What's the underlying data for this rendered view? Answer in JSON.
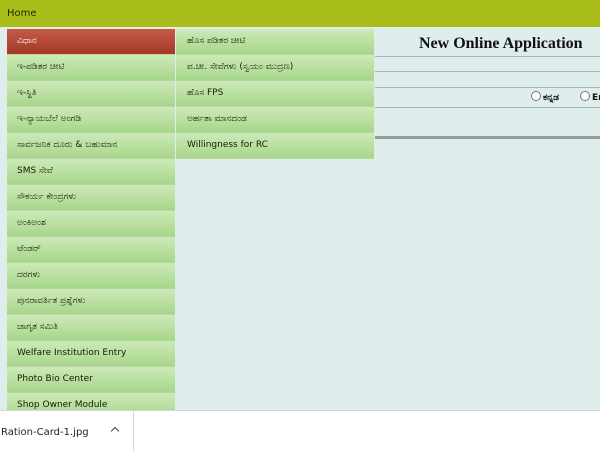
{
  "topbar": {
    "home_label": "Home"
  },
  "app": {
    "title": "New Online Application"
  },
  "language": {
    "kannada": "ಕನ್ನಡ",
    "english_partial": "En"
  },
  "menu": {
    "items": [
      {
        "label": "ವಿಧಾನ",
        "active": true
      },
      {
        "label": "ಇ-ಪಡಿತರ ಚೀಟಿ"
      },
      {
        "label": "ಇ-ಸ್ಥಿತಿ"
      },
      {
        "label": "ಇ-ನ್ಯಾಯಬೆಲೆ ಅಂಗಡಿ"
      },
      {
        "label": "ಸಾರ್ವಜನಿಕ ದೂರು & ಬಹುಮಾನ"
      },
      {
        "label": "SMS ಸೇವೆ"
      },
      {
        "label": "ಸೌಕರ್ಯ ಕೇಂದ್ರಗಳು"
      },
      {
        "label": "ಅಂಕಿಅಂಶ"
      },
      {
        "label": "ಟೆಂಡರ್"
      },
      {
        "label": "ದರಗಳು"
      },
      {
        "label": "ಪುನರಾವರ್ತಿತ ಪ್ರಶ್ನೆಗಳು"
      },
      {
        "label": "ಜಾಗೃತ ಸಮಿತಿ"
      },
      {
        "label": "Welfare Institution Entry"
      },
      {
        "label": "Photo Bio Center"
      },
      {
        "label": "Shop Owner Module"
      }
    ]
  },
  "submenu": {
    "items": [
      {
        "label": "ಹೊಸ ಪಡಿತರ ಚೀಟಿ"
      },
      {
        "label": "ಪ.ಚೀ. ಸೇವೆಗಳು (ಸ್ವಯಂ ಮುದ್ರಣ)"
      },
      {
        "label": "ಹೊಸ FPS"
      },
      {
        "label": "ಅರ್ಹತಾ ಮಾನದಂಡ"
      },
      {
        "label": "Willingness for RC"
      }
    ]
  },
  "downloads": {
    "file_name": "Ration-Card-1.jpg"
  }
}
